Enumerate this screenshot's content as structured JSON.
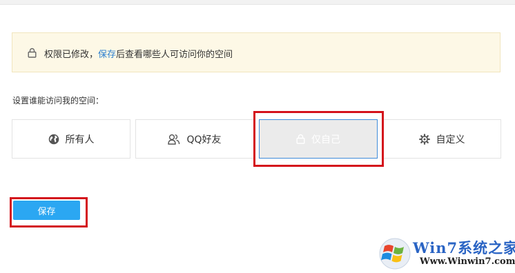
{
  "notice": {
    "text_before": "权限已修改，",
    "link_text": "保存",
    "text_after": "后查看哪些人可访问你的空间"
  },
  "section_label": "设置谁能访问我的空间：",
  "options": [
    {
      "label": "所有人",
      "icon": "globe-icon",
      "selected": false
    },
    {
      "label": "QQ好友",
      "icon": "friends-icon",
      "selected": false
    },
    {
      "label": "仅自己",
      "icon": "lock-icon",
      "selected": true
    },
    {
      "label": "自定义",
      "icon": "gear-icon",
      "selected": false
    }
  ],
  "save_button": {
    "label": "保存"
  },
  "watermark": {
    "title": "Win7系统之家",
    "url": "Www.Winwin7.com"
  },
  "colors": {
    "notice_bg": "#fdf8e6",
    "link": "#2c7fcf",
    "primary_button": "#2ba7f2",
    "selected_border": "#3f8bd9",
    "highlight": "#d4121b"
  }
}
